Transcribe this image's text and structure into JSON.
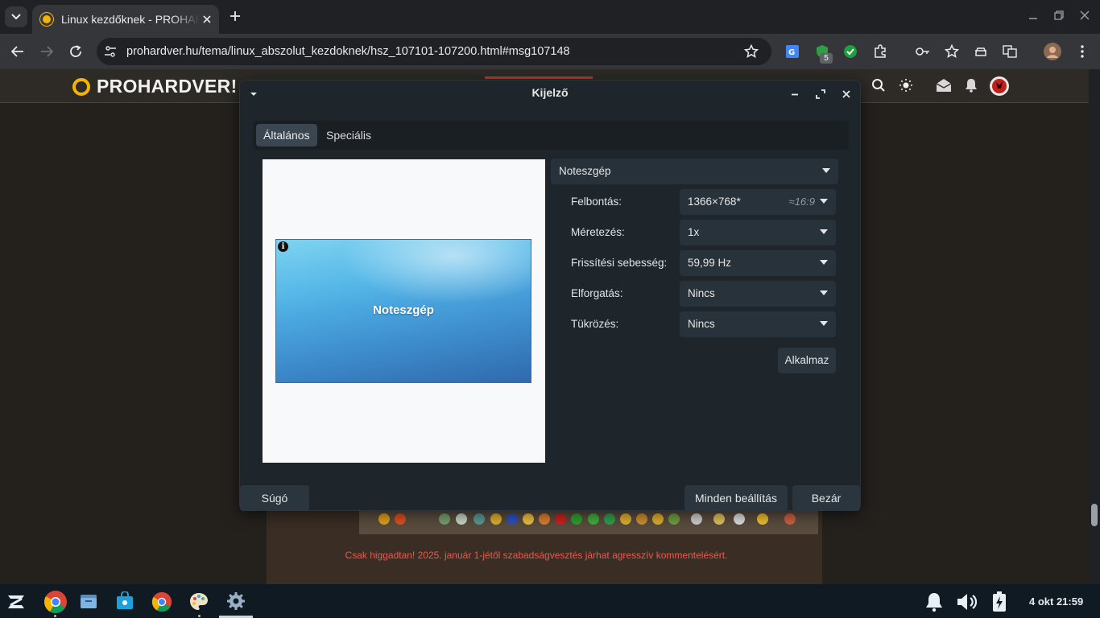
{
  "browser": {
    "tab_title": "Linux kezdőknek - PROHARDVER! Téma",
    "url": "prohardver.hu/tema/linux_abszolut_kezdoknek/hsz_107101-107200.html#msg107148",
    "extension_badge": "5"
  },
  "site": {
    "logo": "PROHARDVER!",
    "warning": "Csak higgadtan! 2025. január 1-jétől szabadságvesztés járhat agresszív kommentelésért."
  },
  "dialog": {
    "title": "Kijelző",
    "tabs": [
      "Általános",
      "Speciális"
    ],
    "active_tab": "Általános",
    "preview_label": "Noteszgép",
    "display_select": "Noteszgép",
    "rows": [
      {
        "label": "Felbontás:",
        "value": "1366×768*",
        "extra": "≈16:9"
      },
      {
        "label": "Méretezés:",
        "value": "1x"
      },
      {
        "label": "Frissítési sebesség:",
        "value": "59,99 Hz"
      },
      {
        "label": "Elforgatás:",
        "value": "Nincs"
      },
      {
        "label": "Tükrözés:",
        "value": "Nincs"
      }
    ],
    "apply": "Alkalmaz",
    "help": "Súgó",
    "all_settings": "Minden beállítás",
    "close": "Bezár"
  },
  "taskbar": {
    "clock": "4 okt 21:59"
  },
  "colors": {
    "dialog_bg": "#1f262b",
    "accent_blue": "#4aa6de",
    "warning_red": "#e85a4f"
  }
}
